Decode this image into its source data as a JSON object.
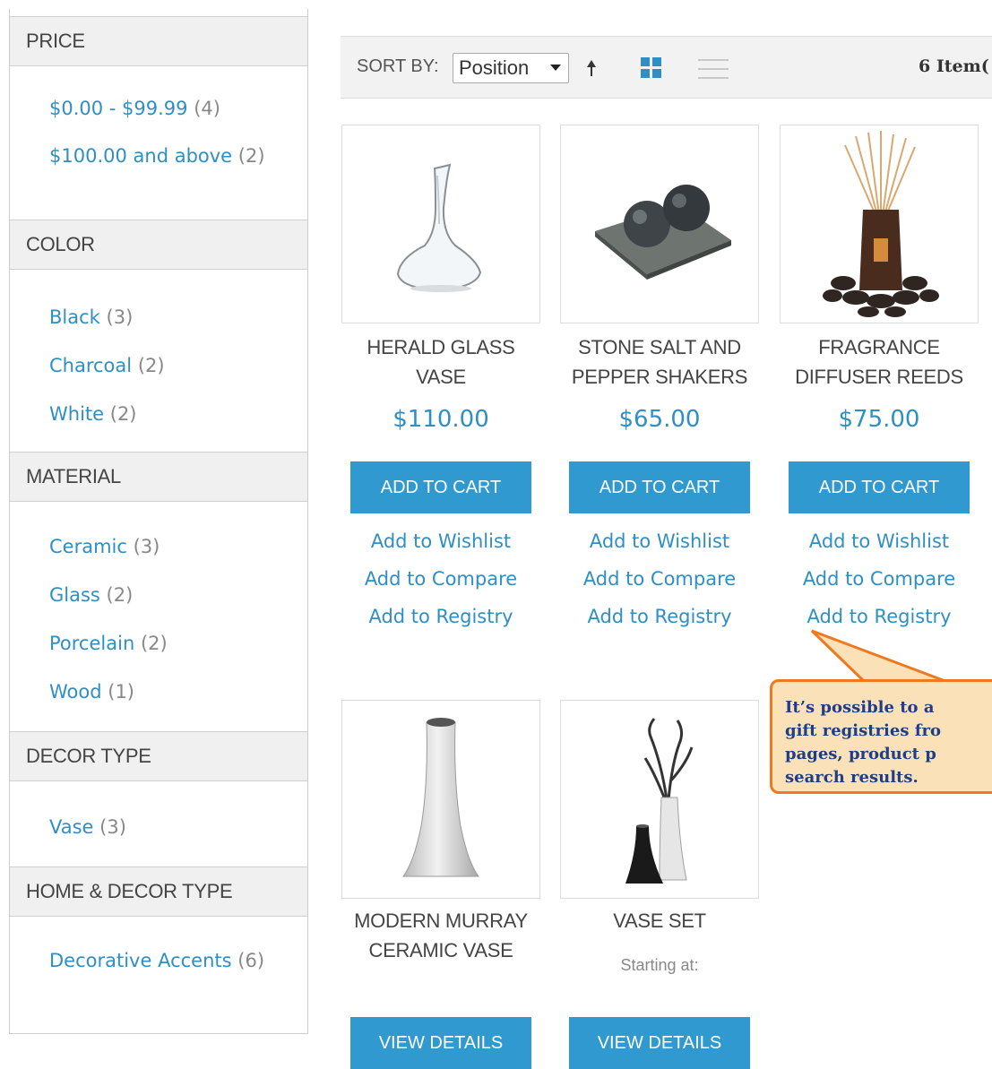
{
  "sidebar": {
    "facets": [
      {
        "title": "PRICE",
        "items": [
          {
            "label": "$0.00 - $99.99",
            "count": "(4)"
          },
          {
            "label": "$100.00 and above",
            "count": "(2)"
          }
        ]
      },
      {
        "title": "COLOR",
        "items": [
          {
            "label": "Black",
            "count": "(3)"
          },
          {
            "label": "Charcoal",
            "count": "(2)"
          },
          {
            "label": "White",
            "count": "(2)"
          }
        ]
      },
      {
        "title": "MATERIAL",
        "items": [
          {
            "label": "Ceramic",
            "count": "(3)"
          },
          {
            "label": "Glass",
            "count": "(2)"
          },
          {
            "label": "Porcelain",
            "count": "(2)"
          },
          {
            "label": "Wood",
            "count": "(1)"
          }
        ]
      },
      {
        "title": "DECOR TYPE",
        "items": [
          {
            "label": "Vase",
            "count": "(3)"
          }
        ]
      },
      {
        "title": "HOME & DECOR TYPE",
        "items": [
          {
            "label": "Decorative Accents",
            "count": "(6)"
          }
        ]
      }
    ]
  },
  "toolbar": {
    "sort_label": "SORT BY:",
    "sort_value": "Position",
    "sort_direction_icon": "arrow-up-icon",
    "grid_icon": "grid-view-icon",
    "list_icon": "list-view-icon",
    "item_count": "6 Item("
  },
  "products": [
    {
      "name_line1": "HERALD GLASS",
      "name_line2": "VASE",
      "price": "$110.00",
      "button": "ADD TO CART",
      "links": [
        "Add to Wishlist",
        "Add to Compare",
        "Add to Registry"
      ]
    },
    {
      "name_line1": "STONE SALT AND",
      "name_line2": "PEPPER SHAKERS",
      "price": "$65.00",
      "button": "ADD TO CART",
      "links": [
        "Add to Wishlist",
        "Add to Compare",
        "Add to Registry"
      ]
    },
    {
      "name_line1": "FRAGRANCE",
      "name_line2": "DIFFUSER REEDS",
      "price": "$75.00",
      "button": "ADD TO CART",
      "links": [
        "Add to Wishlist",
        "Add to Compare",
        "Add to Registry"
      ]
    },
    {
      "name_line1": "MODERN MURRAY",
      "name_line2": "CERAMIC VASE",
      "button": "VIEW DETAILS"
    },
    {
      "name_line1": "VASE SET",
      "starting": "Starting at:",
      "button": "VIEW DETAILS"
    }
  ],
  "callout": {
    "lines": [
      "It’s possible to a",
      "gift registries fro",
      "pages, product p",
      "search results."
    ],
    "border_color": "#f0781e",
    "fill_color": "#fbe1b8",
    "text_color": "#1e3f86"
  },
  "colors": {
    "link": "#2f8fc4",
    "button": "#3099cf",
    "facet_bg": "#f0f0f0"
  }
}
